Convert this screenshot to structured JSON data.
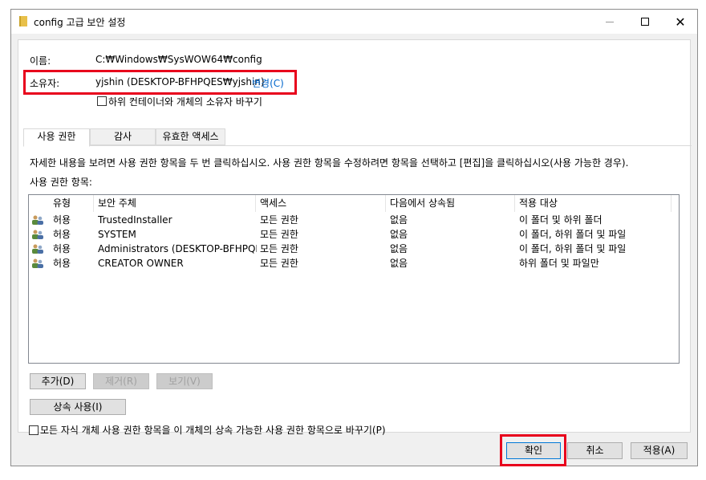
{
  "window": {
    "title": "config 고급 보안 설정"
  },
  "info": {
    "name_label": "이름:",
    "name_value": "C:₩Windows₩SysWOW64₩config",
    "owner_label": "소유자:",
    "owner_value": "yjshin (DESKTOP-BFHPQES₩yjshin)",
    "change_link": "변경(C)",
    "replace_owner_checkbox": "하위 컨테이너와 개체의 소유자 바꾸기"
  },
  "tabs": [
    {
      "label": "사용 권한"
    },
    {
      "label": "감사"
    },
    {
      "label": "유효한 액세스"
    }
  ],
  "description": "자세한 내용을 보려면 사용 권한 항목을 두 번 클릭하십시오. 사용 권한 항목을 수정하려면 항목을 선택하고 [편집]을 클릭하십시오(사용 가능한 경우).",
  "entries_label": "사용 권한 항목:",
  "table": {
    "columns": [
      "유형",
      "보안 주체",
      "액세스",
      "다음에서 상속됨",
      "적용 대상"
    ],
    "rows": [
      {
        "type": "허용",
        "principal": "TrustedInstaller",
        "access": "모든 권한",
        "inherited": "없음",
        "applies": "이 폴더 및 하위 폴더"
      },
      {
        "type": "허용",
        "principal": "SYSTEM",
        "access": "모든 권한",
        "inherited": "없음",
        "applies": "이 폴더, 하위 폴더 및 파일"
      },
      {
        "type": "허용",
        "principal": "Administrators (DESKTOP-BFHPQE...",
        "access": "모든 권한",
        "inherited": "없음",
        "applies": "이 폴더, 하위 폴더 및 파일"
      },
      {
        "type": "허용",
        "principal": "CREATOR OWNER",
        "access": "모든 권한",
        "inherited": "없음",
        "applies": "하위 폴더 및 파일만"
      }
    ]
  },
  "buttons": {
    "add": "추가(D)",
    "remove": "제거(R)",
    "view": "보기(V)",
    "inheritance": "상속 사용(I)",
    "ok": "확인",
    "cancel": "취소",
    "apply": "적용(A)"
  },
  "replace_child_checkbox": "모든 자식 개체 사용 권한 항목을 이 개체의 상속 가능한 사용 권한 항목으로 바꾸기(P)",
  "colors": {
    "highlight_red": "#e8001c",
    "link_blue": "#0066cc",
    "default_button_border": "#0078d7"
  }
}
